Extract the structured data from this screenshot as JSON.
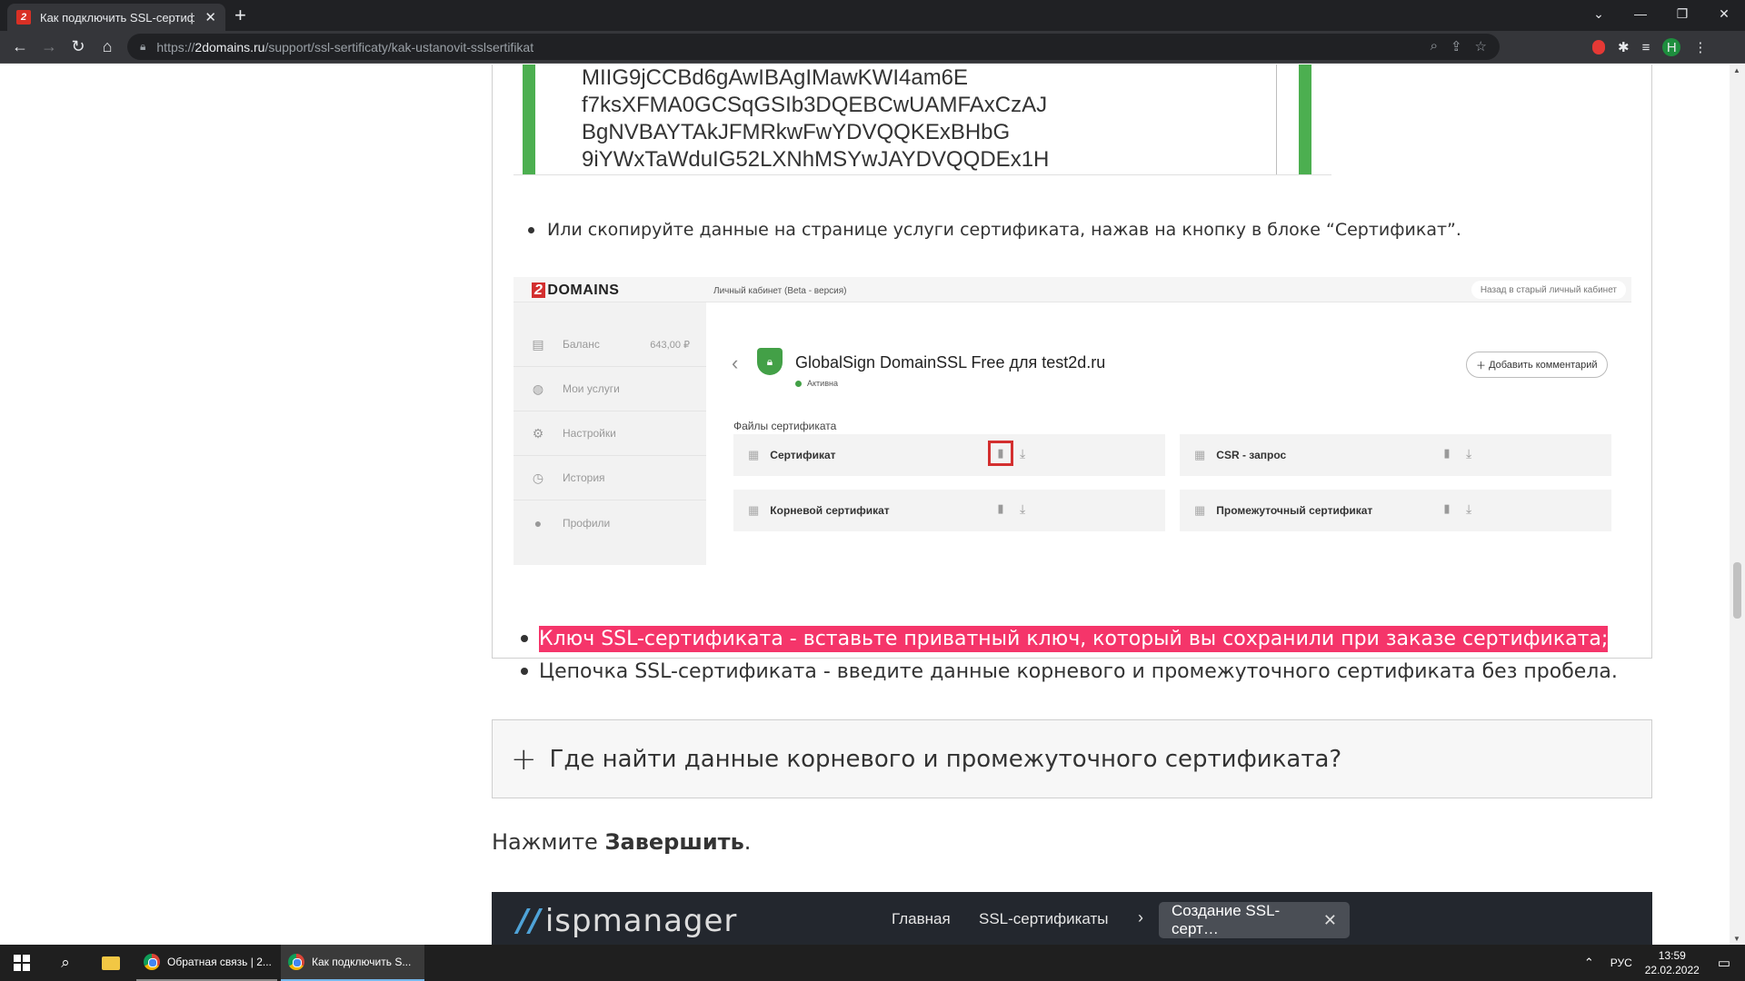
{
  "browser": {
    "tab_title": "Как подключить SSL-сертификат",
    "url_prefix": "https://",
    "url_domain": "2domains.ru",
    "url_path": "/support/ssl-sertificaty/kak-ustanovit-sslsertifikat",
    "avatar_letter": "Н"
  },
  "code_lines": [
    "MIIG9jCCBd6gAwIBAgIMawKWI4am6E",
    "f7ksXFMA0GCSqGSIb3DQEBCwUAMFAxCzAJ",
    "BgNVBAYTAkJFMRkwFwYDVQQKExBHbG",
    "9iYWxTaWduIG52LXNhMSYwJAYDVQQDEx1H"
  ],
  "bullet_copy": "Или скопируйте данные на странице услуги сертификата, нажав на кнопку в блоке “Сертификат”.",
  "shot": {
    "logo_two": "2",
    "logo_text": "DOMAINS",
    "cabinet": "Личный кабинет (Beta - версия)",
    "old_cabinet": "Назад в старый личный кабинет",
    "balance_label": "Баланс",
    "balance_amount": "643,00 ₽",
    "sidebar": [
      "Мои услуги",
      "Настройки",
      "История",
      "Профили"
    ],
    "service_title": "GlobalSign DomainSSL Free для test2d.ru",
    "status": "Активна",
    "add_comment": "Добавить комментарий",
    "files_title": "Файлы сертификата",
    "files": [
      "Сертификат",
      "CSR - запрос",
      "Корневой сертификат",
      "Промежуточный сертификат"
    ],
    "highlight_color": "#d32f2f"
  },
  "bullets": {
    "key": "Ключ SSL-сертификата - вставьте приватный ключ, который вы сохранили при заказе сертификата;",
    "chain": "Цепочка SSL-сертификата - введите данные корневого и промежуточного сертификата без пробела.",
    "highlight_color": "#f5356a"
  },
  "accordion_question": "Где найти данные корневого и промежуточного сертификата?",
  "finish_prefix": "Нажмите",
  "finish_bold": "Завершить",
  "finish_suffix": ".",
  "isp": {
    "logo": "ispmanager",
    "nav_home": "Главная",
    "nav_ssl": "SSL-сертификаты",
    "active_tab": "Создание SSL-серт…"
  },
  "taskbar": {
    "app1": "Обратная связь | 2...",
    "app2": "Как подключить S...",
    "lang": "РУС",
    "time": "13:59",
    "date": "22.02.2022"
  }
}
